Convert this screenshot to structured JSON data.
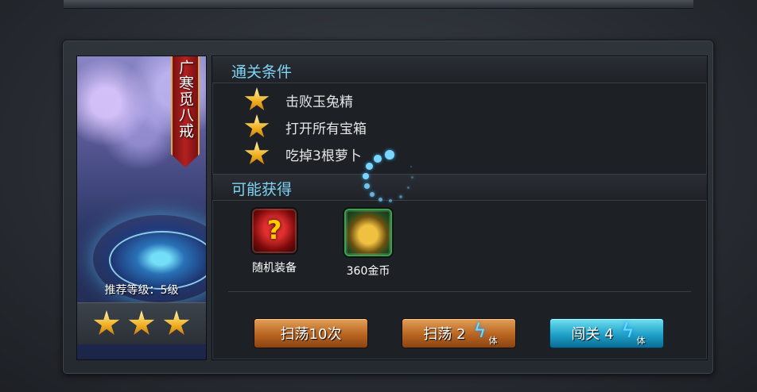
{
  "stage": {
    "name": "广寒觅八戒",
    "recommended_level": "推荐等级：5级",
    "stars_earned": 3
  },
  "conditions": {
    "title": "通关条件",
    "items": [
      "击败玉兔精",
      "打开所有宝箱",
      "吃掉3根萝卜"
    ]
  },
  "rewards": {
    "title": "可能获得",
    "items": [
      {
        "label": "随机装备",
        "icon": "question-equipment-icon"
      },
      {
        "label": "360金币",
        "icon": "gold-coins-icon"
      }
    ]
  },
  "buttons": {
    "sweep10": "扫荡10次",
    "sweep": "扫荡 2",
    "challenge": "闯关 4",
    "stamina_unit": "体"
  },
  "colors": {
    "section_title": "#7ed4f5",
    "orange_button": "#b86420",
    "blue_button": "#1fa0c8",
    "banner_red": "#b22020"
  }
}
